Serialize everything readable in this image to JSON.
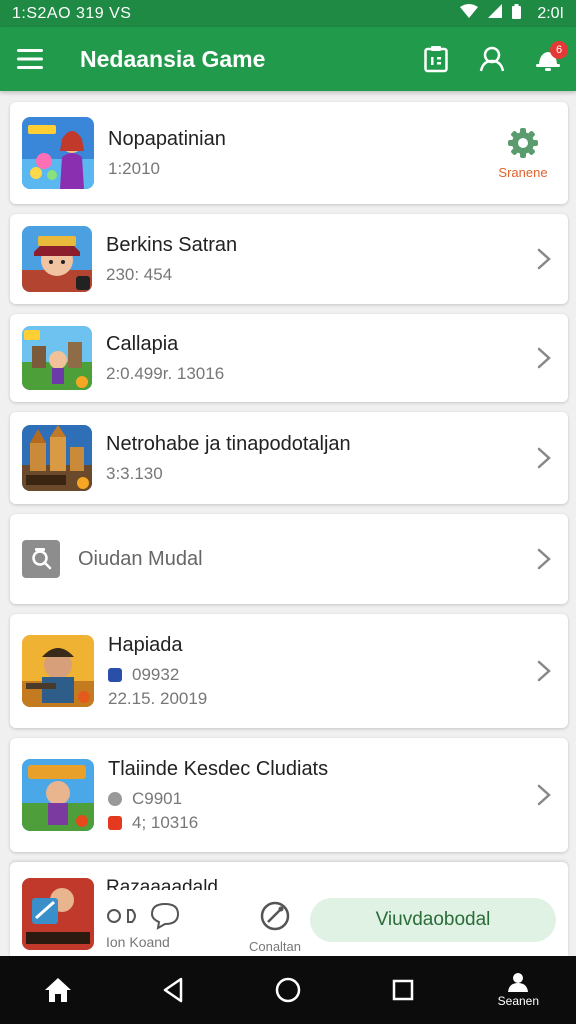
{
  "status_bar": {
    "time": "1:S2AO 319 VS",
    "clock": "2:0I"
  },
  "app_bar": {
    "title": "Nedaansia Game",
    "notification_count": "6"
  },
  "games": [
    {
      "name": "Nopapatinian",
      "meta": [
        "1:2010"
      ],
      "settings_label": "Sranene"
    },
    {
      "name": "Berkins Satran",
      "meta": [
        "230: 454"
      ]
    },
    {
      "name": "Callapia",
      "meta": [
        "2:0.499r. 13016"
      ]
    },
    {
      "name": "Netrohabe ja tinapodotaljan",
      "meta": [
        "3:3.130"
      ]
    },
    {
      "name": "Hapiada",
      "meta": [
        "09932",
        "22.15. 20019"
      ]
    },
    {
      "name": "Tlaiinde Kesdec Cludiats",
      "meta": [
        "C9901",
        "4; 10316"
      ]
    }
  ],
  "search_row": {
    "label": "Oiudan Mudal"
  },
  "bottom_panel": {
    "partial_title": "Razaaaadald",
    "mid_label": "Ion Koand",
    "community_label": "Conaltan",
    "action_label": "Viuvdaobodal"
  },
  "nav": {
    "profile_label": "Seanen"
  },
  "colors": {
    "primary": "#229a4b",
    "accent_orange": "#e0622c",
    "badge_red": "#e53935",
    "pill_bg": "#dff2e3"
  }
}
